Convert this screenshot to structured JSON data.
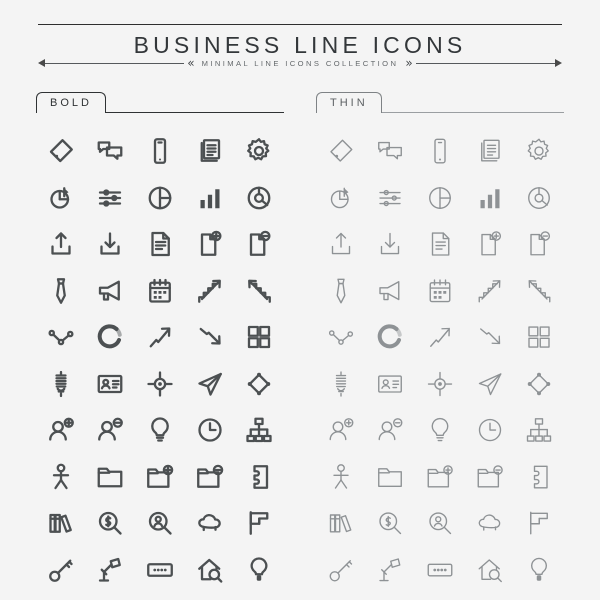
{
  "header": {
    "title": "BUSINESS LINE ICONS",
    "subtitle": "MINIMAL  LINE  ICONS  COLLECTION",
    "chevron_left": "«",
    "chevron_right": "»"
  },
  "sections": [
    {
      "id": "bold",
      "label": "BOLD"
    },
    {
      "id": "thin",
      "label": "THIN"
    }
  ],
  "colors": {
    "background": "#f4f4f4",
    "ink": "#2f3234",
    "icon_bold": "#4c5052",
    "icon_thin": "#8e9295",
    "rule": "#55595c"
  },
  "icons": [
    "tag-icon",
    "chat-bubbles-icon",
    "mobile-phone-icon",
    "documents-stack-icon",
    "gear-icon",
    "pie-chart-pin-icon",
    "sliders-settings-icon",
    "pie-chart-icon",
    "bar-chart-icon",
    "donut-chart-icon",
    "upload-icon",
    "download-icon",
    "document-lines-icon",
    "document-add-icon",
    "document-remove-icon",
    "necktie-icon",
    "megaphone-icon",
    "calendar-icon",
    "stairs-up-icon",
    "stairs-down-icon",
    "connected-nodes-icon",
    "loading-spinner-icon",
    "arrow-up-right-icon",
    "arrow-down-right-icon",
    "grid-squares-icon",
    "spring-coil-icon",
    "id-card-icon",
    "crosshair-target-icon",
    "paper-plane-icon",
    "diamond-nodes-icon",
    "user-add-icon",
    "user-remove-icon",
    "lightbulb-icon",
    "clock-icon",
    "org-chart-icon",
    "person-figure-icon",
    "folder-icon",
    "folder-add-icon",
    "folder-remove-icon",
    "document-puzzle-icon",
    "books-icon",
    "search-dollar-icon",
    "search-user-icon",
    "cloud-icon",
    "flag-icon",
    "key-icon",
    "desk-lamp-icon",
    "password-field-icon",
    "house-search-icon",
    "lightbulb-filled-icon"
  ]
}
